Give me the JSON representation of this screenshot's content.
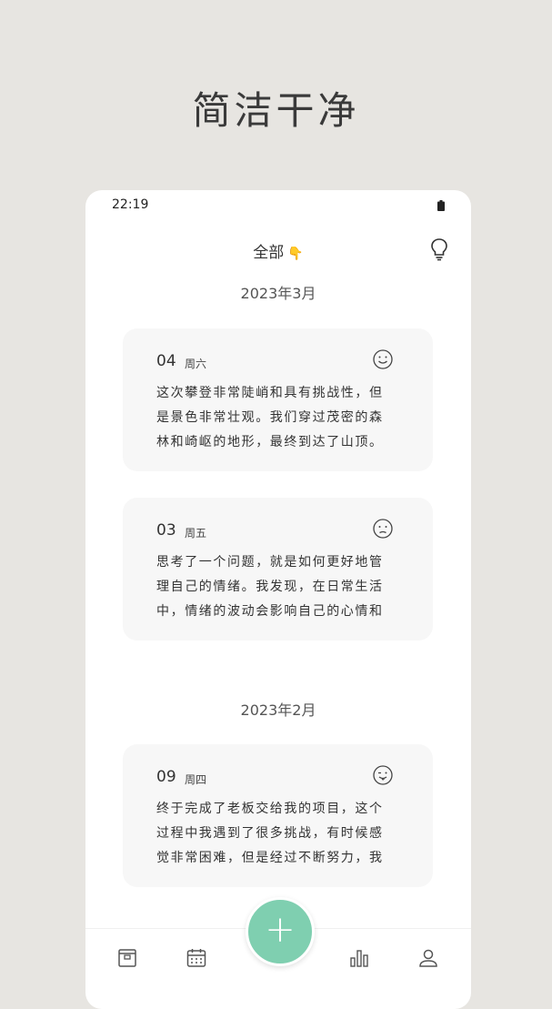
{
  "hero": {
    "title": "简洁干净"
  },
  "status_bar": {
    "time": "22:19"
  },
  "header": {
    "title": "全部",
    "hand_icon": "👇"
  },
  "sections": [
    {
      "month": "2023年3月"
    },
    {
      "month": "2023年2月"
    }
  ],
  "entries": [
    {
      "day": "04",
      "weekday": "周六",
      "mood_icon": "smile-icon",
      "text": "这次攀登非常陡峭和具有挑战性，但是景色非常壮观。我们穿过茂密的森林和崎岖的地形，最终到达了山顶。"
    },
    {
      "day": "03",
      "weekday": "周五",
      "mood_icon": "neutral-face-icon",
      "text": "思考了一个问题，就是如何更好地管理自己的情绪。我发现，在日常生活中，情绪的波动会影响自己的心情和"
    },
    {
      "day": "09",
      "weekday": "周四",
      "mood_icon": "tongue-face-icon",
      "text": "终于完成了老板交给我的项目，这个过程中我遇到了很多挑战，有时候感觉非常困难，但是经过不断努力，我"
    }
  ],
  "fab": {
    "label": "+"
  },
  "tabs": [
    "archive-icon",
    "calendar-icon",
    "stats-icon",
    "profile-icon"
  ],
  "colors": {
    "background": "#e7e5e1",
    "accent": "#7fcfb0",
    "card": "#f7f7f7"
  }
}
